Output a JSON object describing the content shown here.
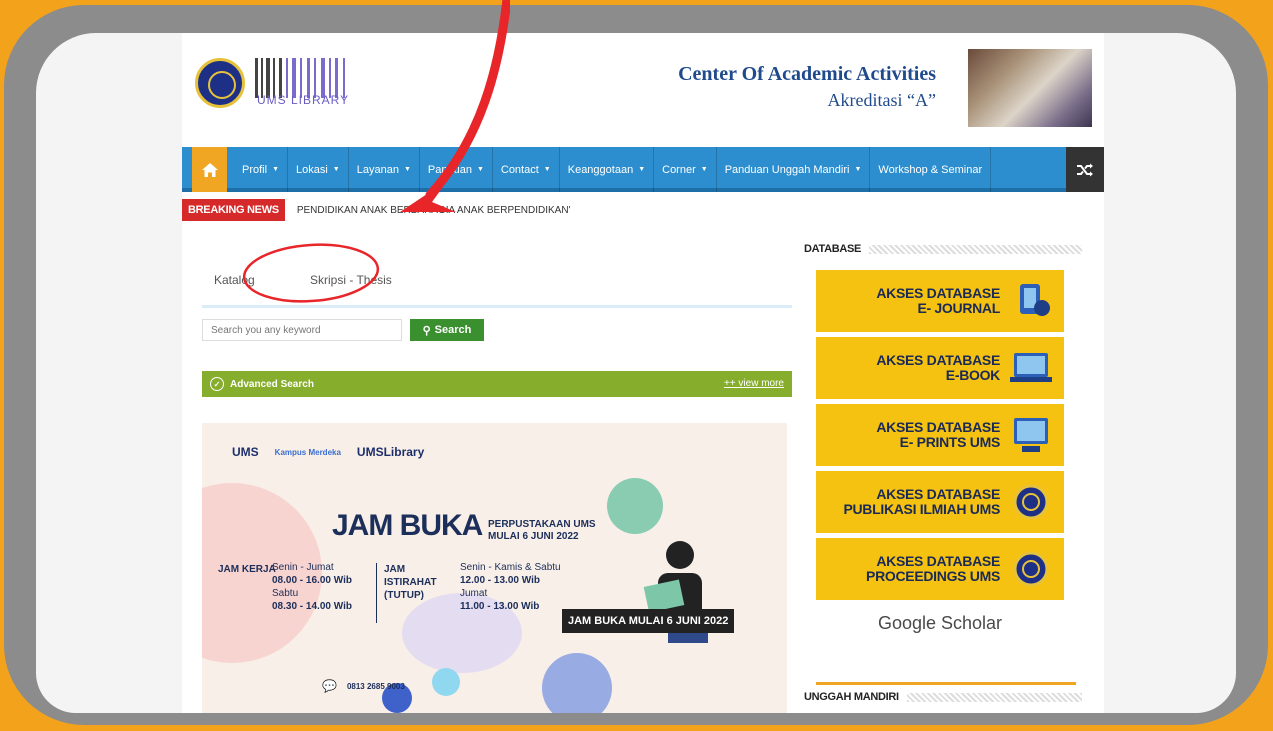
{
  "header": {
    "library_logo_text": "UMS LIBRARY",
    "title": "Center Of Academic Activities",
    "subtitle": "Akreditasi “A”"
  },
  "nav": {
    "items": [
      {
        "label": "Profil",
        "caret": true
      },
      {
        "label": "Lokasi",
        "caret": true
      },
      {
        "label": "Layanan",
        "caret": true
      },
      {
        "label": "Panduan",
        "caret": true
      },
      {
        "label": "Contact",
        "caret": true
      },
      {
        "label": "Keanggotaan",
        "caret": true
      },
      {
        "label": "Corner",
        "caret": true
      },
      {
        "label": "Panduan Unggah Mandiri",
        "caret": true
      },
      {
        "label": "Workshop & Seminar",
        "caret": false
      }
    ],
    "home_icon": "home-icon",
    "shuffle_icon": "shuffle-icon"
  },
  "breaking": {
    "label": "BREAKING NEWS",
    "text": "PENDIDIKAN ANAK BERBAHAGIA ANAK BERPENDIDIKAN'"
  },
  "search": {
    "tabs": [
      "Katalog",
      "Skripsi - Thesis"
    ],
    "placeholder": "Search you any keyword",
    "button": "Search",
    "advanced": "Advanced Search",
    "view_more": "++ view more"
  },
  "banner": {
    "ums": "UMS",
    "kampus": "Kampus Merdeka",
    "umslibrary": "UMSLibrary",
    "title": "JAM BUKA",
    "sub_line1": "PERPUSTAKAAN UMS",
    "sub_line2": "MULAI 6 JUNI 2022",
    "jam_kerja_label": "JAM KERJA",
    "jam_kerja_day1": "Senin - Jumat",
    "jam_kerja_time1": "08.00 - 16.00 Wib",
    "jam_kerja_day2": "Sabtu",
    "jam_kerja_time2": "08.30 - 14.00 Wib",
    "istirahat_label": "JAM ISTIRAHAT (TUTUP)",
    "istirahat_day1": "Senin - Kamis & Sabtu",
    "istirahat_time1": "12.00 - 13.00 Wib",
    "istirahat_day2": "Jumat",
    "istirahat_time2": "11.00 - 13.00 Wib",
    "caption": "JAM BUKA MULAI 6 JUNI 2022",
    "phone": "0813 2685 9003"
  },
  "sidebar": {
    "database_title": "DATABASE",
    "cards": [
      {
        "line1": "AKSES DATABASE",
        "line2": "E- JOURNAL",
        "icon": "journal-icon"
      },
      {
        "line1": "AKSES DATABASE",
        "line2": "E-BOOK",
        "icon": "ebook-icon"
      },
      {
        "line1": "AKSES DATABASE",
        "line2": "E- PRINTS UMS",
        "icon": "eprints-icon"
      },
      {
        "line1": "AKSES DATABASE",
        "line2": "PUBLIKASI ILMIAH UMS",
        "icon": "ums-seal-icon"
      },
      {
        "line1": "AKSES DATABASE",
        "line2": "PROCEEDINGS UMS",
        "icon": "ums-seal-icon"
      }
    ],
    "google_scholar": "Google Scholar",
    "unggah_title": "UNGGAH MANDIRI"
  },
  "colors": {
    "accent_orange": "#f3a21c",
    "nav_blue": "#2c8ecf",
    "breaking_red": "#d62a2a",
    "search_green": "#3a8f2e",
    "adv_green": "#86ae2c",
    "db_yellow": "#f5c211",
    "annotation_red": "#e8262a"
  }
}
